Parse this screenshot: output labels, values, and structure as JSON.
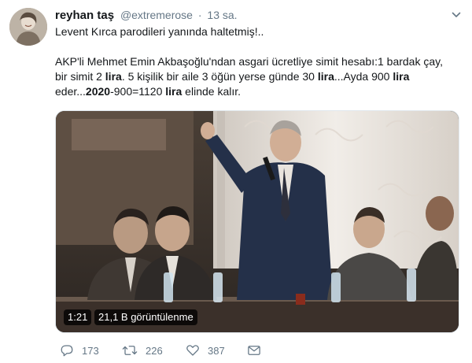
{
  "user": {
    "name": "reyhan taş",
    "handle": "@extremerose",
    "separator": "·",
    "time": "13 sa."
  },
  "tweet": {
    "intro": "Levent Kırca parodileri yanında haltetmiş!..",
    "p2_l1": "AKP'li Mehmet Emin Akbaşoğlu'ndan asgari ücretliye simit hesabı:1 bardak çay,",
    "p2_l2_a": "bir simit 2 ",
    "p2_l2_b": "lira",
    "p2_l2_c": ". 5 kişilik bir aile 3 öğün yerse günde 30 ",
    "p2_l2_d": "lira",
    "p2_l2_e": "...Ayda 900 ",
    "p2_l2_f": "lira",
    "p2_l3_a": "eder...",
    "p2_l3_b": "2020",
    "p2_l3_c": "-900=1120 ",
    "p2_l3_d": "lira",
    "p2_l3_e": " elinde kalır."
  },
  "video": {
    "duration": "1:21",
    "views": "21,1 B görüntülenme"
  },
  "actions": {
    "replies": "173",
    "retweets": "226",
    "likes": "387"
  },
  "icons": {
    "reply": "reply-icon",
    "retweet": "retweet-icon",
    "like": "heart-icon",
    "dm": "envelope-icon",
    "menu": "chevron-down-icon"
  },
  "colors": {
    "secondary_text": "#657786",
    "primary_text": "#14171a"
  }
}
